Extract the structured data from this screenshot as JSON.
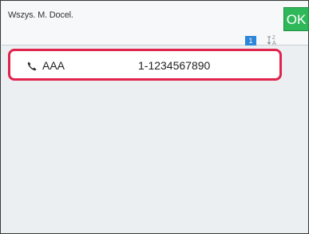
{
  "header": {
    "title": "Wszys. M. Docel.",
    "ok_label": "OK",
    "page_number": "1",
    "sort_icon": "sort-az-icon"
  },
  "list": {
    "items": [
      {
        "icon": "phone-icon",
        "name": "AAA",
        "number": "1-1234567890",
        "selected": true
      }
    ]
  },
  "colors": {
    "ok_button": "#2fb85a",
    "page_badge": "#2d86d9",
    "selection_border": "#e0244c"
  }
}
